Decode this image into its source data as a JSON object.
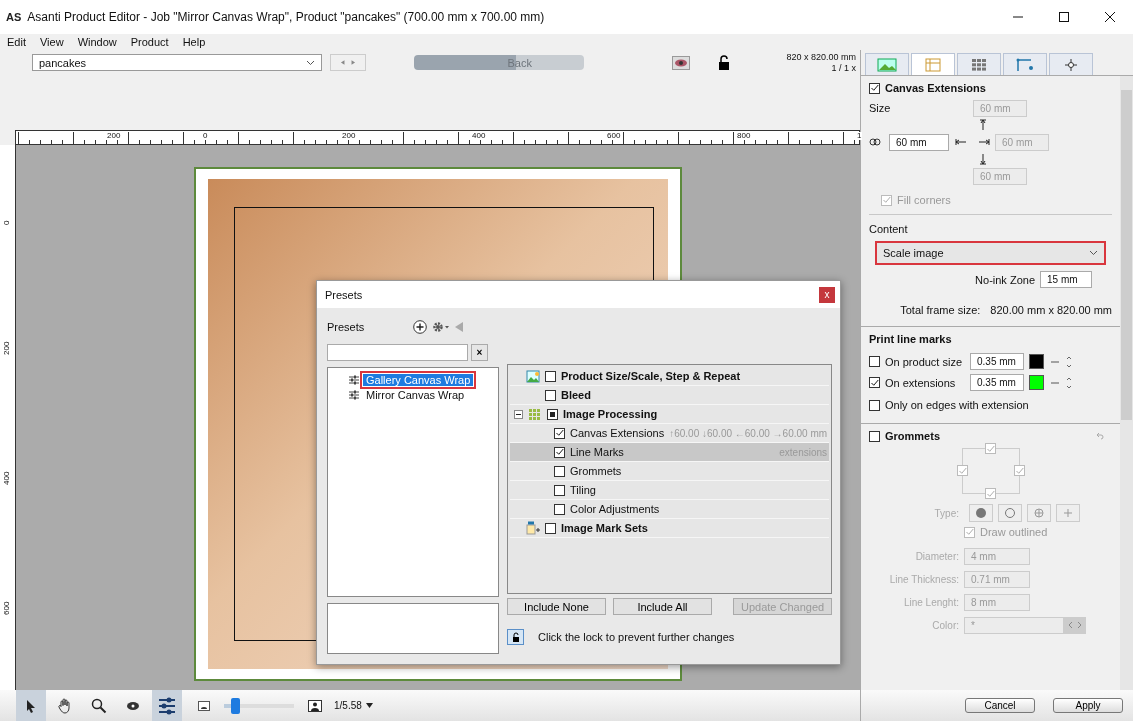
{
  "window": {
    "logo": "AS",
    "title": "Asanti Product Editor - Job \"Mirror Canvas Wrap\", Product \"pancakes\" (700.00 mm x 700.00 mm)"
  },
  "menu": [
    "Edit",
    "View",
    "Window",
    "Product",
    "Help"
  ],
  "toolbar": {
    "product": "pancakes",
    "back": "Back",
    "size": "820 x 820.00 mm",
    "scale": "1 / 1 x"
  },
  "ruler": {
    "h_labels": [
      "200",
      "0",
      "200",
      "400",
      "600",
      "800",
      "1"
    ],
    "v_labels": [
      "0",
      "200",
      "400",
      "600"
    ]
  },
  "canvas_extensions": {
    "label": "Canvas Extensions",
    "checked": true,
    "size_label": "Size",
    "top": "60 mm",
    "left": "60 mm",
    "right": "60 mm",
    "bottom": "60 mm",
    "fill_corners": {
      "label": "Fill corners",
      "checked": true
    }
  },
  "content": {
    "label": "Content",
    "value": "Scale image",
    "highlighted": true,
    "no_ink_label": "No-ink Zone",
    "no_ink": "15 mm",
    "total_label": "Total frame size:",
    "total": "820.00 mm x 820.00 mm"
  },
  "print_line_marks": {
    "title": "Print line marks",
    "rows": [
      {
        "label": "On product size",
        "checked": false,
        "width": "0.35 mm",
        "color": "#000000"
      },
      {
        "label": "On extensions",
        "checked": true,
        "width": "0.35 mm",
        "color": "#00ff00"
      }
    ],
    "only_edges": {
      "label": "Only on edges with extension",
      "checked": false
    }
  },
  "grommets": {
    "label": "Grommets",
    "checked": false,
    "sides": [
      {
        "checked": true
      },
      {
        "checked": true
      },
      {
        "checked": true
      },
      {
        "checked": true
      }
    ],
    "type_label": "Type:",
    "draw_outlined": {
      "label": "Draw outlined",
      "checked": true
    },
    "fields": [
      {
        "label": "Diameter:",
        "value": "4 mm",
        "disabled": true
      },
      {
        "label": "Line Thickness:",
        "value": "0.71 mm",
        "disabled": true
      },
      {
        "label": "Line Lenght:",
        "value": "8 mm",
        "disabled": true
      },
      {
        "label": "Color:",
        "value": "*",
        "disabled": true
      }
    ]
  },
  "footer_buttons": [
    "Cancel",
    "Apply"
  ],
  "bottom_toolbar": {
    "level": 0.15,
    "zoom": "1/5.58"
  },
  "presets_dialog": {
    "title": "Presets",
    "close": "x",
    "list_label": "Presets",
    "clear": "×",
    "presets": [
      {
        "label": "Gallery Canvas Wrap",
        "selected": true,
        "highlighted": true
      },
      {
        "label": "Mirror Canvas Wrap",
        "selected": false,
        "highlighted": false
      }
    ],
    "sections": [
      {
        "label": "Product Size/Scale, Step & Repeat",
        "checked": false,
        "kind": "image"
      },
      {
        "label": "Bleed",
        "checked": false,
        "kind": "plain"
      },
      {
        "label": "Image Processing",
        "checked": true,
        "partial": true,
        "kind": "grid",
        "expanded": true,
        "children": [
          {
            "label": "Canvas Extensions",
            "checked": true,
            "detail": "↑60.00 ↓60.00 ←60.00 →60.00 mm",
            "selected": false
          },
          {
            "label": "Line Marks",
            "checked": true,
            "detail": "extensions",
            "selected": true
          },
          {
            "label": "Grommets",
            "checked": false,
            "selected": false
          },
          {
            "label": "Tiling",
            "checked": false,
            "selected": false
          },
          {
            "label": "Color Adjustments",
            "checked": false,
            "selected": false
          }
        ]
      },
      {
        "label": "Image Mark Sets",
        "checked": false,
        "kind": "text"
      }
    ],
    "buttons": [
      {
        "label": "Include None",
        "disabled": false
      },
      {
        "label": "Include All",
        "disabled": false
      },
      {
        "label": "Update Changed",
        "disabled": true
      }
    ],
    "lock_hint": "Click the lock to prevent further changes"
  }
}
